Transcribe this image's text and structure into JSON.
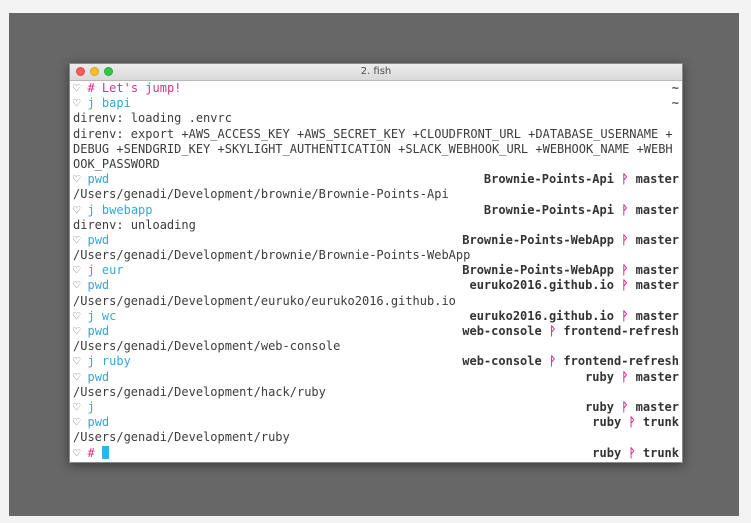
{
  "window": {
    "title": "2. fish"
  },
  "prompt_symbol": "♡",
  "branch_symbol": "ᚹ",
  "lines": [
    {
      "type": "prompt",
      "comment": "# Let's jump!",
      "right_tilde": "~"
    },
    {
      "type": "prompt",
      "cmd": "j bapi",
      "right_tilde": "~"
    },
    {
      "type": "output",
      "text": "direnv: loading .envrc"
    },
    {
      "type": "output",
      "text": "direnv: export +AWS_ACCESS_KEY +AWS_SECRET_KEY +CLOUDFRONT_URL +DATABASE_USERNAME +DEBUG +SENDGRID_KEY +SKYLIGHT_AUTHENTICATION +SLACK_WEBHOOK_URL +WEBHOOK_NAME +WEBHOOK_PASSWORD"
    },
    {
      "type": "prompt",
      "cmd": "pwd",
      "repo": "Brownie-Points-Api",
      "branch": "master"
    },
    {
      "type": "output",
      "text": "/Users/genadi/Development/brownie/Brownie-Points-Api"
    },
    {
      "type": "prompt",
      "cmd": "j bwebapp",
      "repo": "Brownie-Points-Api",
      "branch": "master"
    },
    {
      "type": "output",
      "text": "direnv: unloading"
    },
    {
      "type": "prompt",
      "cmd": "pwd",
      "repo": "Brownie-Points-WebApp",
      "branch": "master"
    },
    {
      "type": "output",
      "text": "/Users/genadi/Development/brownie/Brownie-Points-WebApp"
    },
    {
      "type": "prompt",
      "cmd": "j eur",
      "repo": "Brownie-Points-WebApp",
      "branch": "master"
    },
    {
      "type": "prompt",
      "cmd": "pwd",
      "repo": "euruko2016.github.io",
      "branch": "master"
    },
    {
      "type": "output",
      "text": "/Users/genadi/Development/euruko/euruko2016.github.io"
    },
    {
      "type": "prompt",
      "cmd": "j wc",
      "repo": "euruko2016.github.io",
      "branch": "master"
    },
    {
      "type": "prompt",
      "cmd": "pwd",
      "repo": "web-console",
      "branch": "frontend-refresh"
    },
    {
      "type": "output",
      "text": "/Users/genadi/Development/web-console"
    },
    {
      "type": "prompt",
      "cmd": "j ruby",
      "repo": "web-console",
      "branch": "frontend-refresh"
    },
    {
      "type": "prompt",
      "cmd": "pwd",
      "repo": "ruby",
      "branch": "master"
    },
    {
      "type": "output",
      "text": "/Users/genadi/Development/hack/ruby"
    },
    {
      "type": "prompt",
      "cmd": "j",
      "repo": "ruby",
      "branch": "master"
    },
    {
      "type": "prompt",
      "cmd": "pwd",
      "repo": "ruby",
      "branch": "trunk"
    },
    {
      "type": "output",
      "text": "/Users/genadi/Development/ruby"
    },
    {
      "type": "current",
      "comment": "#",
      "repo": "ruby",
      "branch": "trunk"
    }
  ],
  "colors": {
    "command": "#36a7d8",
    "comment": "#d6338a",
    "branch_icon": "#d6338a",
    "cursor": "#29b6e8"
  }
}
